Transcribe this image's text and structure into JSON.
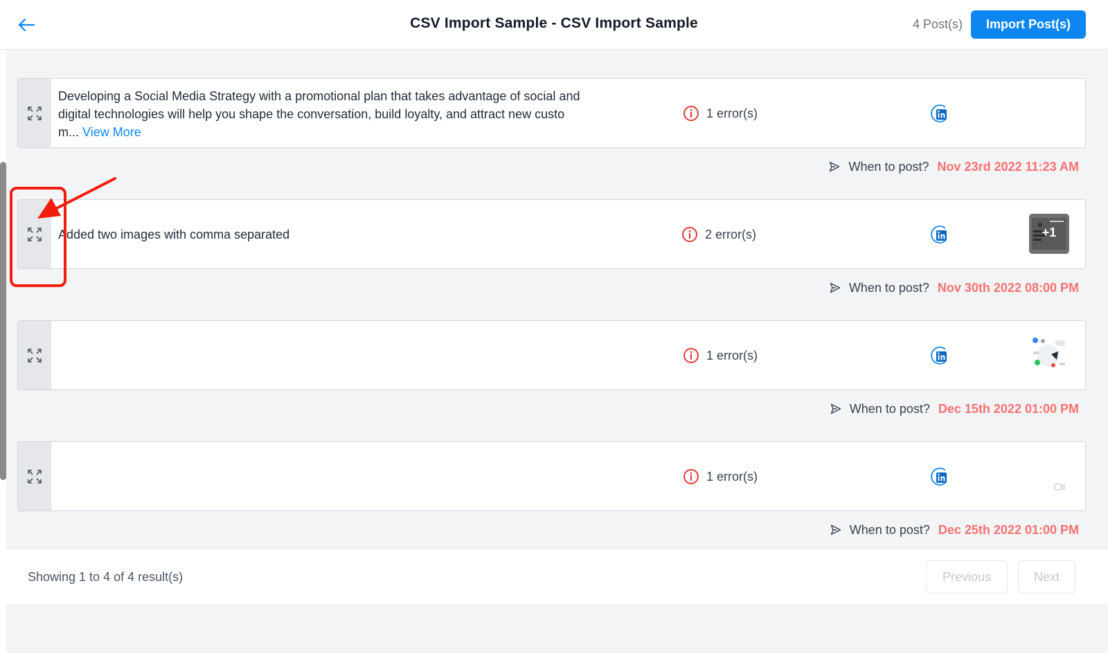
{
  "header": {
    "title": "CSV Import Sample - CSV Import Sample",
    "post_count": "4 Post(s)",
    "import_label": "Import Post(s)",
    "back_icon": "arrow-left-icon"
  },
  "colors": {
    "accent": "#0d86f2",
    "date": "#f87171",
    "error": "#e53935",
    "annotation": "#f21c0d"
  },
  "posts": [
    {
      "text": "Developing a Social Media Strategy with a promotional plan that takes advantage of social and digital technologies will help you shape the conversation, build loyalty, and attract new custom...",
      "view_more": "View More",
      "errors": "1 error(s)",
      "network_icon": "linkedin-icon",
      "media": "",
      "when_label": "When to post?",
      "when_date": "Nov 23rd 2022 11:23 AM"
    },
    {
      "text": "Added two images with comma separated",
      "view_more": "",
      "errors": "2 error(s)",
      "network_icon": "linkedin-icon",
      "media": "image-thumbnail",
      "media_extra": "+1",
      "when_label": "When to post?",
      "when_date": "Nov 30th 2022 08:00 PM"
    },
    {
      "text": "",
      "view_more": "",
      "errors": "1 error(s)",
      "network_icon": "linkedin-icon",
      "media": "image-thumbnail",
      "when_label": "When to post?",
      "when_date": "Dec 15th 2022 01:00 PM"
    },
    {
      "text": "",
      "view_more": "",
      "errors": "1 error(s)",
      "network_icon": "linkedin-icon",
      "media": "video-icon",
      "when_label": "When to post?",
      "when_date": "Dec 25th 2022 01:00 PM"
    }
  ],
  "pagination": {
    "showing": "Showing 1 to 4 of 4 result(s)",
    "previous": "Previous",
    "next": "Next"
  },
  "icons": {
    "expand": "expand-icon",
    "error": "info-circle-icon",
    "when": "send-icon"
  }
}
